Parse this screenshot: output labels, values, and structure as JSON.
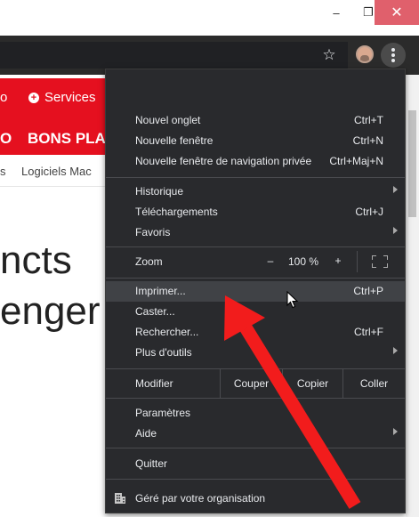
{
  "page": {
    "nav": {
      "left_fragment": "o",
      "services": "Services"
    },
    "bons": {
      "left_fragment": "O",
      "text": "BONS PLA"
    },
    "subnav": {
      "left_fragment": "s",
      "item": "Logiciels Mac"
    },
    "heading": {
      "line1": "ncts",
      "line2": "enger"
    }
  },
  "window": {
    "minimize": "–",
    "maximize": "❐",
    "close": "✕"
  },
  "toolbar": {
    "star_icon": "star-icon",
    "menu_icon": "kebab-icon"
  },
  "menu": {
    "group1": [
      {
        "label": "Nouvel onglet",
        "shortcut": "Ctrl+T"
      },
      {
        "label": "Nouvelle fenêtre",
        "shortcut": "Ctrl+N"
      },
      {
        "label": "Nouvelle fenêtre de navigation privée",
        "shortcut": "Ctrl+Maj+N"
      }
    ],
    "group2": [
      {
        "label": "Historique",
        "submenu": true
      },
      {
        "label": "Téléchargements",
        "shortcut": "Ctrl+J"
      },
      {
        "label": "Favoris",
        "submenu": true
      }
    ],
    "zoom": {
      "label": "Zoom",
      "minus": "–",
      "value": "100 %",
      "plus": "+"
    },
    "group3": [
      {
        "label": "Imprimer...",
        "shortcut": "Ctrl+P",
        "highlighted": true
      },
      {
        "label": "Caster..."
      },
      {
        "label": "Rechercher...",
        "shortcut": "Ctrl+F"
      },
      {
        "label": "Plus d'outils",
        "submenu": true
      }
    ],
    "edit": {
      "label": "Modifier",
      "cut": "Couper",
      "copy": "Copier",
      "paste": "Coller"
    },
    "group4": [
      {
        "label": "Paramètres"
      },
      {
        "label": "Aide",
        "submenu": true
      }
    ],
    "quit": {
      "label": "Quitter"
    },
    "managed": {
      "label": "Géré par votre organisation"
    }
  },
  "colors": {
    "menu_bg": "#292a2d",
    "highlight": "#404246",
    "brand_red": "#e5101f",
    "arrow_red": "#f21c1c",
    "close_red": "#e0606c"
  }
}
